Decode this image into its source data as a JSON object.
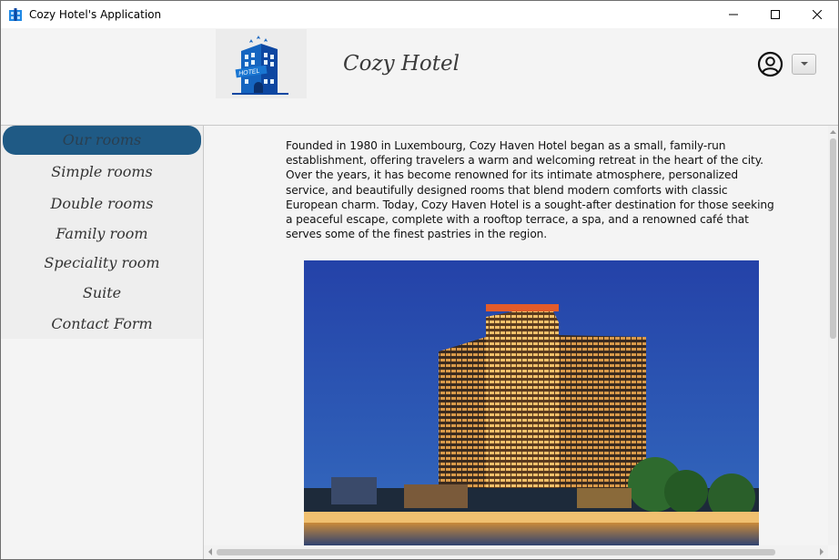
{
  "window": {
    "title": "Cozy Hotel's Application"
  },
  "header": {
    "brand": "Cozy Hotel",
    "logo_text": "HOTEL"
  },
  "sidebar": {
    "items": [
      {
        "label": "Our rooms",
        "active": true
      },
      {
        "label": "Simple rooms"
      },
      {
        "label": "Double rooms"
      },
      {
        "label": "Family room"
      },
      {
        "label": "Speciality room"
      },
      {
        "label": "Suite"
      },
      {
        "label": "Contact Form"
      }
    ]
  },
  "main": {
    "intro": "Founded in 1980 in Luxembourg, Cozy Haven Hotel began as a small, family-run establishment, offering travelers a warm and welcoming retreat in the heart of the city. Over the years, it has become renowned for its intimate atmosphere, personalized service, and beautifully designed rooms that blend modern comforts with classic European charm. Today, Cozy Haven Hotel is a sought-after destination for those seeking a peaceful escape, complete with a rooftop terrace, a spa, and a renowned café that serves some of the finest pastries in the region."
  },
  "colors": {
    "accent": "#1f5a85",
    "logo_blue": "#1565c0",
    "sky": "#2c4fa8"
  }
}
